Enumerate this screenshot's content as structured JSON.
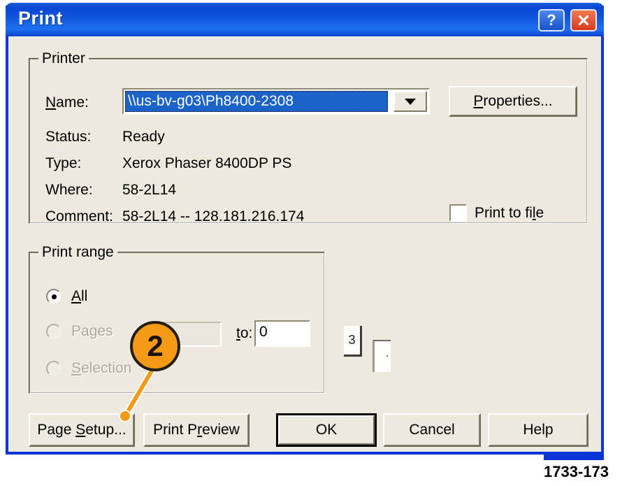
{
  "window": {
    "title": "Print",
    "help_button": "?",
    "close_button": "close-icon"
  },
  "printer_group": {
    "legend": "Printer",
    "name_label": "Name:",
    "name_value": "\\\\us-bv-g03\\Ph8400-2308",
    "dropdown_icon": "chevron-down-icon",
    "properties_button": "Properties...",
    "status_label": "Status:",
    "status_value": "Ready",
    "type_label": "Type:",
    "type_value": "Xerox Phaser 8400DP PS",
    "where_label": "Where:",
    "where_value": "58-2L14",
    "comment_label": "Comment:",
    "comment_value": "58-2L14 -- 128.181.216.174",
    "print_to_file_label": "Print to file",
    "print_to_file_checked": false
  },
  "print_range_group": {
    "legend": "Print range",
    "options": [
      {
        "label": "All",
        "selected": true,
        "disabled": false
      },
      {
        "label": "Pages",
        "selected": false,
        "disabled": true
      },
      {
        "label": "Selection",
        "selected": false,
        "disabled": true
      }
    ],
    "pages_from_value": "",
    "to_label": "to:",
    "pages_to_value": "0"
  },
  "copies_group": {
    "number_of_copies_value": "3"
  },
  "buttons": {
    "page_setup": "Page Setup...",
    "print_preview": "Print Preview",
    "ok": "OK",
    "cancel": "Cancel",
    "help": "Help"
  },
  "callout": {
    "number": "2"
  },
  "figure": {
    "caption": "1733-173"
  },
  "colors": {
    "titlebar_blue": "#0a47d4",
    "window_border_blue": "#0a36d8",
    "dialog_face": "#ede9de",
    "selection_blue": "#1b63c9",
    "close_red": "#d8391c",
    "callout_orange": "#f59a16",
    "callout_outline": "#231f16"
  }
}
